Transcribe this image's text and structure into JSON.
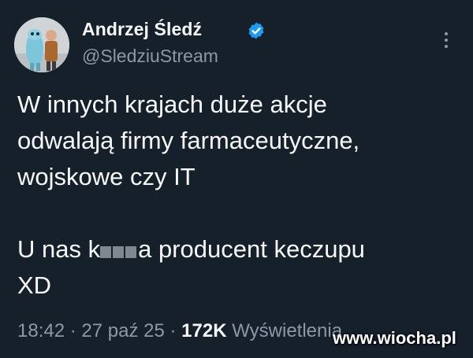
{
  "tweet": {
    "author": {
      "name": "Andrzej Śledź",
      "handle": "@SledziuStream",
      "verified": true
    },
    "text": {
      "line1": "W innych krajach duże akcje",
      "line2": "odwalają firmy farmaceutyczne,",
      "line3": "wojskowe czy IT",
      "line5_prefix": "U nas k",
      "line5_suffix": "a producent keczupu",
      "line6": "XD"
    },
    "meta": {
      "time": "18:42",
      "separator1": "·",
      "date": "27 paź 25",
      "separator2": "·",
      "views": "172K",
      "views_label": "Wyświetlenia"
    }
  },
  "watermark": "www.wiocha.pl",
  "colors": {
    "background": "#15202b",
    "text": "#f7f9f9",
    "secondary": "#8b98a5",
    "verified": "#1d9bf0"
  },
  "icons": {
    "verified": "verified-badge-icon",
    "more": "more-options-icon"
  }
}
